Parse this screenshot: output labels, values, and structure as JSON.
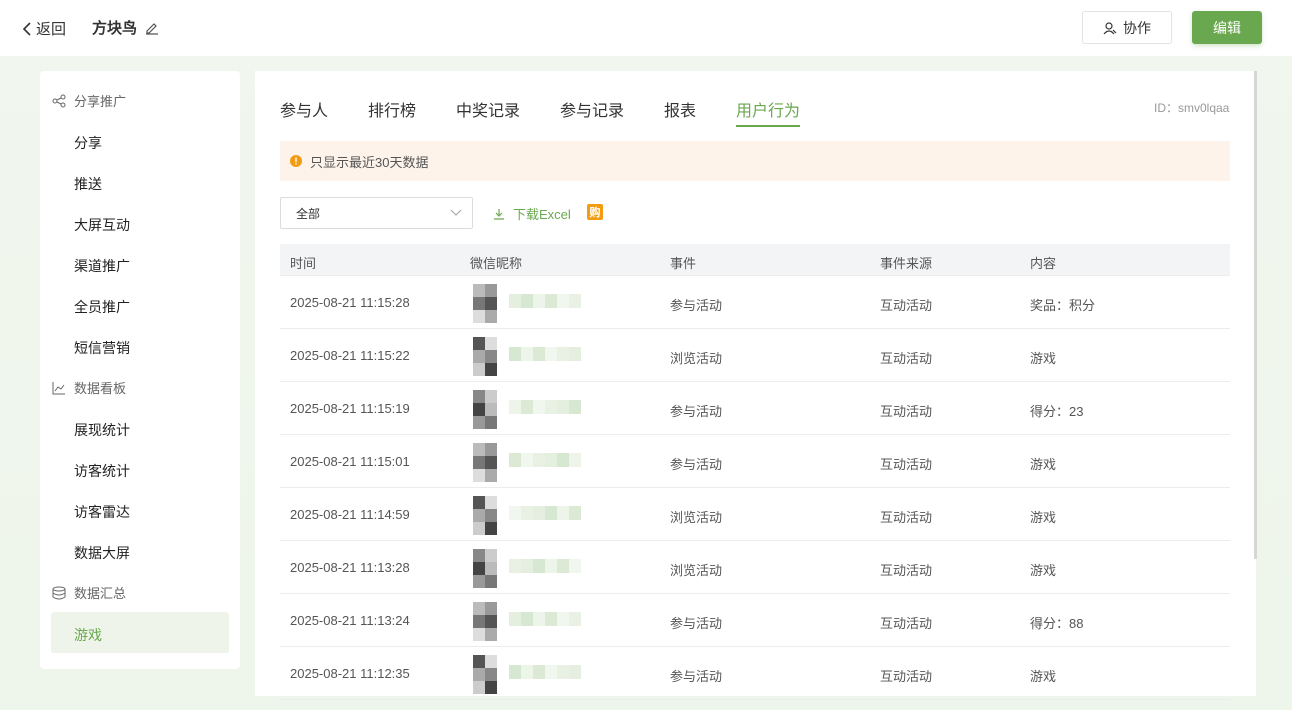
{
  "header": {
    "back_label": "返回",
    "title": "方块鸟",
    "collab_label": "协作",
    "edit_label": "编辑"
  },
  "sidebar": {
    "groups": [
      {
        "label": "分享推广",
        "icon": "share-icon",
        "items": [
          "分享",
          "推送",
          "大屏互动",
          "渠道推广",
          "全员推广",
          "短信营销"
        ]
      },
      {
        "label": "数据看板",
        "icon": "line-chart-icon",
        "items": [
          "展现统计",
          "访客统计",
          "访客雷达",
          "数据大屏"
        ]
      },
      {
        "label": "数据汇总",
        "icon": "database-icon",
        "items": [
          "游戏"
        ]
      }
    ],
    "active_item": "游戏"
  },
  "tabs": [
    "参与人",
    "排行榜",
    "中奖记录",
    "参与记录",
    "报表",
    "用户行为"
  ],
  "active_tab": "用户行为",
  "id_label": "ID：smv0lqaa",
  "notice": "只显示最近30天数据",
  "filter": {
    "selected": "全部"
  },
  "download_label": "下载Excel",
  "buy_badge": "购",
  "table": {
    "columns": [
      "时间",
      "微信昵称",
      "事件",
      "事件来源",
      "内容"
    ],
    "rows": [
      {
        "time": "2025-08-21 11:15:28",
        "event": "参与活动",
        "source": "互动活动",
        "content": "奖品：积分"
      },
      {
        "time": "2025-08-21 11:15:22",
        "event": "浏览活动",
        "source": "互动活动",
        "content": "游戏"
      },
      {
        "time": "2025-08-21 11:15:19",
        "event": "参与活动",
        "source": "互动活动",
        "content": "得分：23"
      },
      {
        "time": "2025-08-21 11:15:01",
        "event": "参与活动",
        "source": "互动活动",
        "content": "游戏"
      },
      {
        "time": "2025-08-21 11:14:59",
        "event": "浏览活动",
        "source": "互动活动",
        "content": "游戏"
      },
      {
        "time": "2025-08-21 11:13:28",
        "event": "浏览活动",
        "source": "互动活动",
        "content": "游戏"
      },
      {
        "time": "2025-08-21 11:13:24",
        "event": "参与活动",
        "source": "互动活动",
        "content": "得分：88"
      },
      {
        "time": "2025-08-21 11:12:35",
        "event": "参与活动",
        "source": "互动活动",
        "content": "游戏"
      }
    ]
  },
  "colors": {
    "accent": "#6aa84f",
    "notice_bg": "#fdf3ea",
    "warn": "#f39c12"
  }
}
